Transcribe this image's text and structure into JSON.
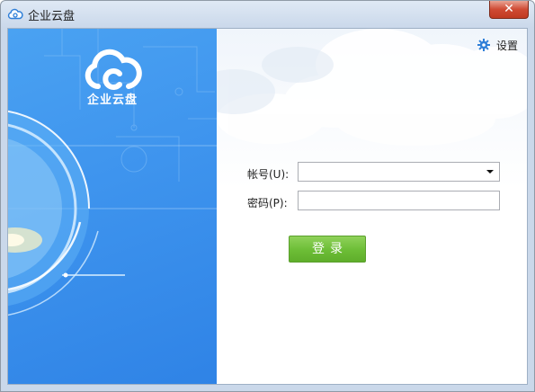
{
  "window": {
    "title": "企业云盘",
    "close_glyph": "✕"
  },
  "brand": {
    "logo_text": "企业云盘",
    "logo_icon": "cloud-c-icon",
    "accent_color": "#3f95ee"
  },
  "header": {
    "settings_label": "设置",
    "settings_icon": "gear-icon"
  },
  "form": {
    "account_label": "帐号(U):",
    "account_value": "",
    "password_label": "密码(P):",
    "password_value": "",
    "login_label": "登录",
    "login_color": "#6cbd36"
  }
}
